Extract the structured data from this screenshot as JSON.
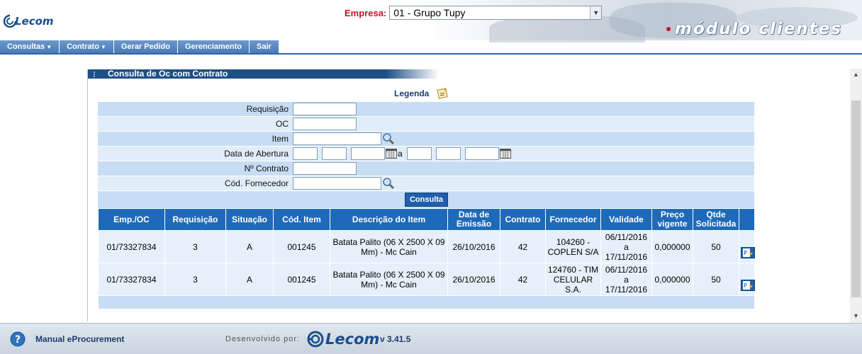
{
  "header": {
    "logo_text": "Lecom",
    "empresa_label": "Empresa:",
    "empresa_value": "01 - Grupo Tupy",
    "modulo": "módulo clientes"
  },
  "menu": {
    "items": [
      {
        "label": "Consultas",
        "caret": "▼"
      },
      {
        "label": "Contrato",
        "caret": "▼"
      },
      {
        "label": "Gerar Pedido",
        "caret": ""
      },
      {
        "label": "Gerenciamento",
        "caret": ""
      },
      {
        "label": "Sair",
        "caret": ""
      }
    ]
  },
  "panel": {
    "title": "Consulta de Oc com Contrato",
    "legenda": "Legenda"
  },
  "form": {
    "requisicao_label": "Requisição",
    "oc_label": "OC",
    "item_label": "Item",
    "data_abertura_label": "Data de Abertura",
    "sep_a": "a",
    "contrato_label": "Nº Contrato",
    "fornecedor_label": "Cód. Fornecedor",
    "consulta_button": "Consulta"
  },
  "table": {
    "headers": [
      "Emp./OC",
      "Requisição",
      "Situação",
      "Cód. Item",
      "Descrição do Item",
      "Data de Emissão",
      "Contrato",
      "Fornecedor",
      "Validade",
      "Preço vigente",
      "Qtde Solicitada"
    ],
    "rows": [
      {
        "emp_oc": "01/73327834",
        "requisicao": "3",
        "situacao": "A",
        "cod_item": "001245",
        "descricao": "Batata Palito (06 X 2500 X 09 Mm) - Mc Cain",
        "data_emissao": "26/10/2016",
        "contrato": "42",
        "fornecedor": "104260 - COPLEN S/A",
        "validade": "06/11/2016 a 17/11/2016",
        "preco": "0,000000",
        "qtde": "50"
      },
      {
        "emp_oc": "01/73327834",
        "requisicao": "3",
        "situacao": "A",
        "cod_item": "001245",
        "descricao": "Batata Palito (06 X 2500 X 09 Mm) - Mc Cain",
        "data_emissao": "26/10/2016",
        "contrato": "42",
        "fornecedor": "124760 - TIM CELULAR S.A.",
        "validade": "06/11/2016 a 17/11/2016",
        "preco": "0,000000",
        "qtde": "50"
      }
    ]
  },
  "footer": {
    "manual": "Manual eProcurement",
    "dev": "Desenvolvido por:",
    "logo_text": "Lecom",
    "version": "v 3.41.5"
  },
  "colors": {
    "menu_blue": "#4a7bb7",
    "panel_header": "#1e4f86",
    "table_header": "#1f6ab8",
    "empresa_red": "#c0152b"
  }
}
